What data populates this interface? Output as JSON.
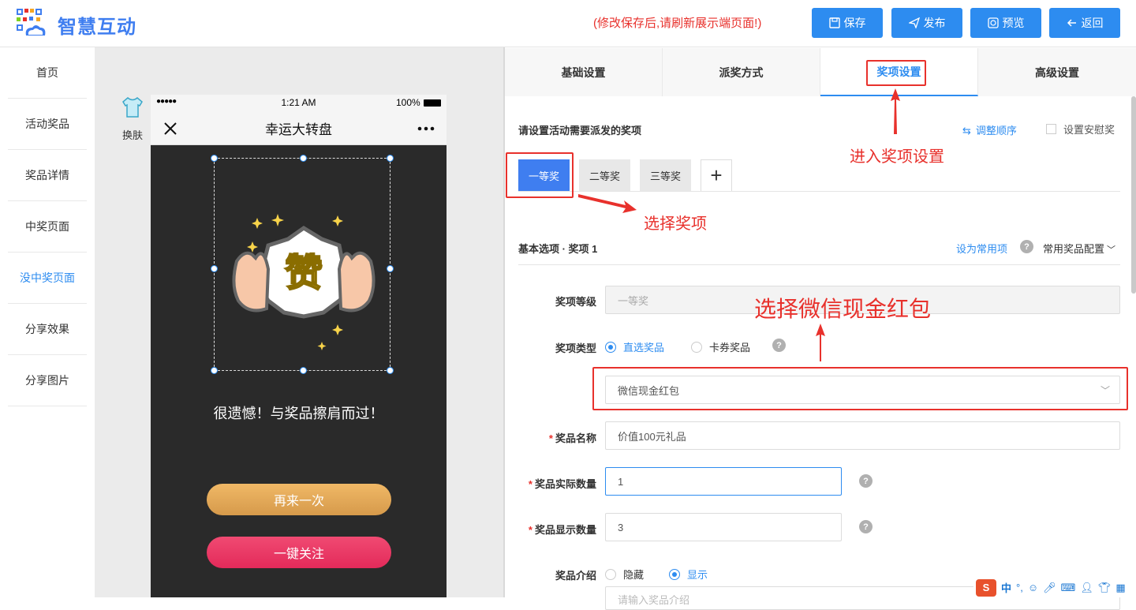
{
  "header": {
    "app_title": "智慧互动",
    "save_tip": "(修改保存后,请刷新展示端页面!)",
    "buttons": {
      "save": "保存",
      "publish": "发布",
      "preview": "预览",
      "back": "返回"
    }
  },
  "sidebar": {
    "items": [
      {
        "label": "首页"
      },
      {
        "label": "活动奖品"
      },
      {
        "label": "奖品详情"
      },
      {
        "label": "中奖页面"
      },
      {
        "label": "没中奖页面",
        "active": true
      },
      {
        "label": "分享效果"
      },
      {
        "label": "分享图片"
      }
    ]
  },
  "preview": {
    "skin_label": "换肤",
    "status": {
      "signal": "●●●●●",
      "time": "1:21 AM",
      "battery": "100%"
    },
    "nav_title": "幸运大转盘",
    "sticker_text": "赞",
    "message": "很遗憾！与奖品擦肩而过！",
    "retry_button": "再来一次",
    "follow_button": "一键关注"
  },
  "tabs": [
    {
      "label": "基础设置"
    },
    {
      "label": "派奖方式"
    },
    {
      "label": "奖项设置",
      "active": true
    },
    {
      "label": "高级设置"
    }
  ],
  "panel": {
    "title": "请设置活动需要派发的奖项",
    "reorder": "调整顺序",
    "consolation": "设置安慰奖",
    "prize_tabs": [
      "一等奖",
      "二等奖",
      "三等奖"
    ],
    "add_tab": "+",
    "basic_title": "基本选项 · 奖项 1",
    "set_common": "设为常用项",
    "common_config": "常用奖品配置",
    "help": "?",
    "fields": {
      "level": {
        "label": "奖项等级",
        "value": "一等奖"
      },
      "type": {
        "label": "奖项类型",
        "opt1": "直选奖品",
        "opt2": "卡券奖品"
      },
      "subtype": {
        "value": "微信现金红包"
      },
      "name": {
        "label": "奖品名称",
        "value": "价值100元礼品"
      },
      "actual_qty": {
        "label": "奖品实际数量",
        "value": "1"
      },
      "display_qty": {
        "label": "奖品显示数量",
        "value": "3"
      },
      "intro": {
        "label": "奖品介绍",
        "opt1": "隐藏",
        "opt2": "显示"
      },
      "intro_placeholder": "请输入奖品介绍"
    }
  },
  "annotations": {
    "enter_prize_settings": "进入奖项设置",
    "select_prize": "选择奖项",
    "select_wechat_cash": "选择微信现金红包"
  },
  "ime": {
    "lang": "中",
    "punct": "°,"
  },
  "colors": {
    "accent": "#2d8cf0",
    "annotation": "#e8312c",
    "brand": "#3f7ef0"
  }
}
